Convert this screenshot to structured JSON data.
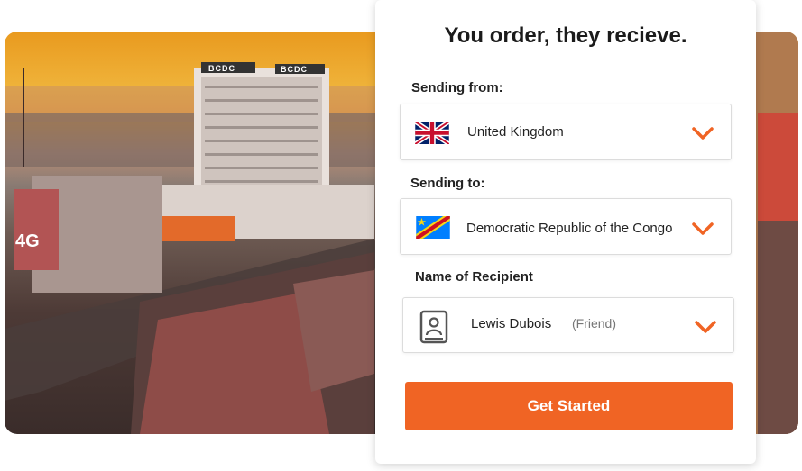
{
  "card": {
    "title": "You order, they recieve.",
    "sending_from": {
      "label": "Sending from:",
      "value": "United Kingdom",
      "flag_icon": "uk-flag-icon"
    },
    "sending_to": {
      "label": "Sending to:",
      "value": "Democratic Republic of the Congo",
      "flag_icon": "drc-flag-icon"
    },
    "recipient": {
      "label": "Name of Recipient",
      "name": "Lewis Dubois",
      "relation": "(Friend)",
      "icon": "contact-book-icon"
    },
    "cta_label": "Get Started"
  },
  "colors": {
    "accent": "#f06424",
    "chevron": "#f06424",
    "text": "#1b1b1b"
  },
  "background": {
    "sign_left": "BCDC",
    "sign_right": "BCDC",
    "billboard": "4G"
  }
}
